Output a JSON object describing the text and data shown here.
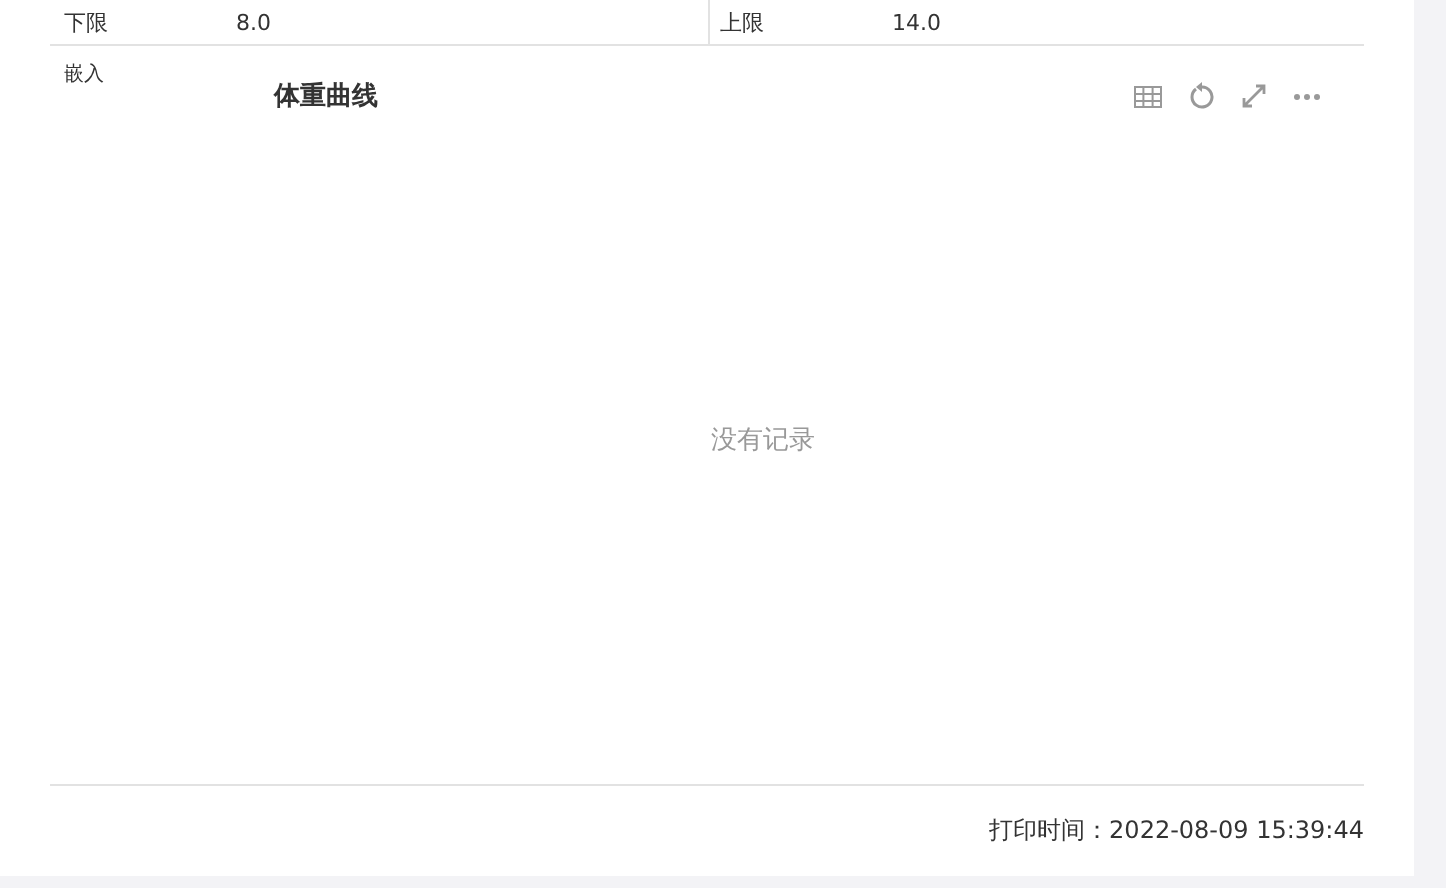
{
  "limits": [
    {
      "label": "下限",
      "value": "8.0"
    },
    {
      "label": "上限",
      "value": "14.0"
    }
  ],
  "embed_label": "嵌入",
  "chart": {
    "title": "体重曲线",
    "empty_text": "没有记录"
  },
  "print_time": "打印时间：2022-08-09 15:39:44"
}
